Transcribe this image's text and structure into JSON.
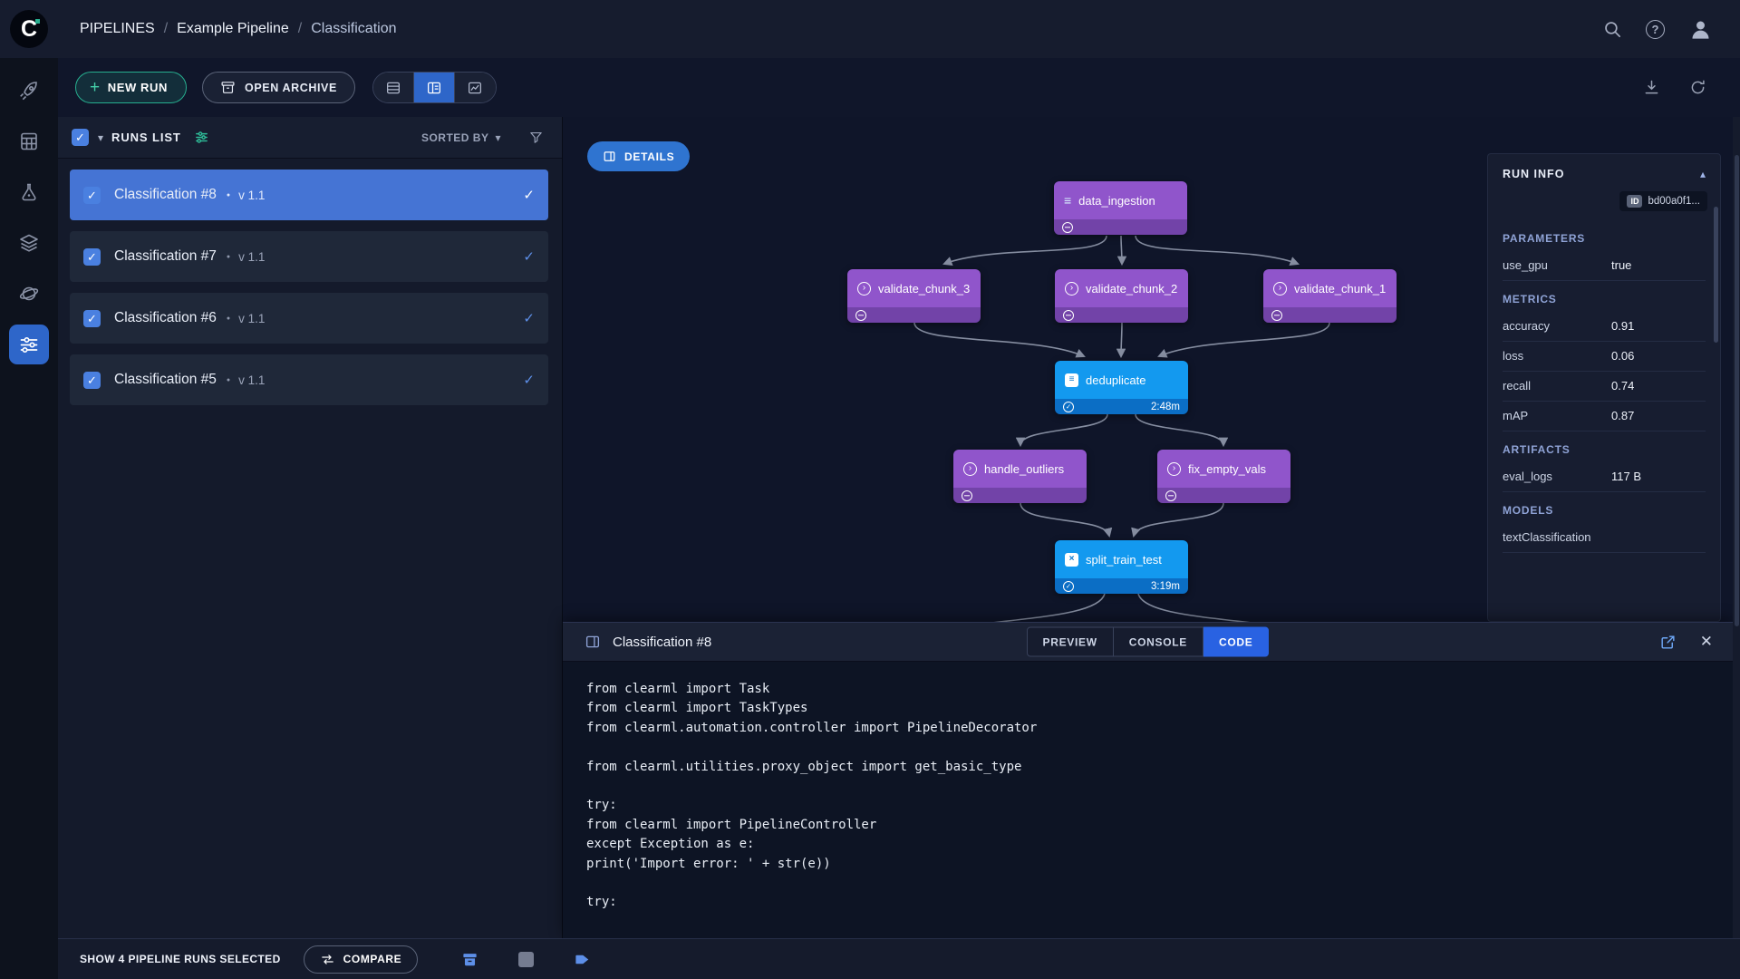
{
  "icons": {
    "caret_down": "▾",
    "caret_up": "▴",
    "check": "✓",
    "close": "✕",
    "plus": "+",
    "question": "?",
    "dot": "●"
  },
  "colors": {
    "accent_blue": "#2e66c9",
    "accent_teal": "#27ae8f",
    "node_purple": "#9055cb",
    "node_blue": "#1399ef",
    "selected_row": "#4574d4"
  },
  "header": {
    "logo_letter": "C",
    "breadcrumb": {
      "root": "PIPELINES",
      "sep": "/",
      "project": "Example Pipeline",
      "page": "Classification"
    }
  },
  "toolbar": {
    "new_run_label": "NEW RUN",
    "open_archive_label": "OPEN ARCHIVE"
  },
  "runs_list": {
    "title": "RUNS LIST",
    "sorted_by_label": "SORTED BY",
    "rows": [
      {
        "name": "Classification #8",
        "version": "v 1.1",
        "selected": true,
        "checked": true
      },
      {
        "name": "Classification #7",
        "version": "v 1.1",
        "selected": false,
        "checked": true
      },
      {
        "name": "Classification #6",
        "version": "v 1.1",
        "selected": false,
        "checked": true
      },
      {
        "name": "Classification #5",
        "version": "v 1.1",
        "selected": false,
        "checked": true
      }
    ]
  },
  "graph": {
    "details_label": "DETAILS",
    "nodes": [
      {
        "label": "data_ingestion",
        "status": "cached"
      },
      {
        "label": "validate_chunk_3",
        "status": "cached"
      },
      {
        "label": "validate_chunk_2",
        "status": "cached"
      },
      {
        "label": "validate_chunk_1",
        "status": "cached"
      },
      {
        "label": "deduplicate",
        "status": "completed",
        "time": "2:48m"
      },
      {
        "label": "handle_outliers",
        "status": "cached"
      },
      {
        "label": "fix_empty_vals",
        "status": "cached"
      },
      {
        "label": "split_train_test",
        "status": "completed",
        "time": "3:19m"
      }
    ]
  },
  "run_info": {
    "title": "RUN INFO",
    "id_badge": "ID",
    "id_value": "bd00a0f1...",
    "parameters_title": "PARAMETERS",
    "parameters": [
      {
        "label": "use_gpu",
        "value": "true"
      }
    ],
    "metrics_title": "METRICS",
    "metrics": [
      {
        "label": "accuracy",
        "value": "0.91"
      },
      {
        "label": "loss",
        "value": "0.06"
      },
      {
        "label": "recall",
        "value": "0.74"
      },
      {
        "label": "mAP",
        "value": "0.87"
      }
    ],
    "artifacts_title": "ARTIFACTS",
    "artifacts": [
      {
        "label": "eval_logs",
        "value": "117 B"
      }
    ],
    "models_title": "MODELS",
    "models": [
      {
        "label": "textClassification"
      }
    ]
  },
  "bottom_panel": {
    "title": "Classification #8",
    "tabs": {
      "preview": "PREVIEW",
      "console": "CONSOLE",
      "code": "CODE"
    },
    "code": [
      "from clearml import Task",
      "from clearml import TaskTypes",
      "from clearml.automation.controller import PipelineDecorator",
      "",
      "from clearml.utilities.proxy_object import get_basic_type",
      "",
      "try:",
      "from clearml import PipelineController",
      "except Exception as e:",
      "print('Import error: ' + str(e))",
      "",
      "try:"
    ]
  },
  "footer": {
    "selection_text": "SHOW 4 PIPELINE RUNS SELECTED",
    "compare_label": "COMPARE"
  }
}
